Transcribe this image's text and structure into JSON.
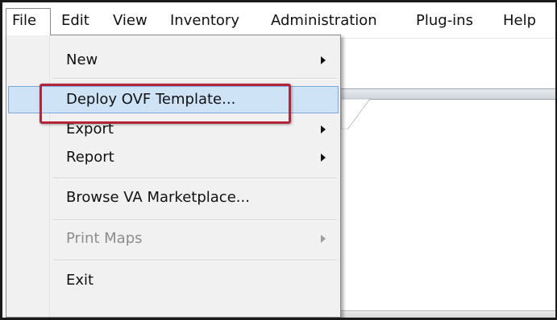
{
  "menubar": {
    "items": [
      {
        "label": "File"
      },
      {
        "label": "Edit"
      },
      {
        "label": "View"
      },
      {
        "label": "Inventory"
      },
      {
        "label": "Administration"
      },
      {
        "label": "Plug-ins"
      },
      {
        "label": "Help"
      }
    ],
    "active_menu": "File"
  },
  "file_menu": {
    "items": [
      {
        "label": "New",
        "has_submenu": true,
        "enabled": true
      },
      {
        "label": "Deploy OVF Template...",
        "has_submenu": false,
        "enabled": true,
        "highlighted": true
      },
      {
        "label": "Export",
        "has_submenu": true,
        "enabled": true
      },
      {
        "label": "Report",
        "has_submenu": true,
        "enabled": true
      },
      {
        "label": "Browse VA Marketplace...",
        "has_submenu": false,
        "enabled": true
      },
      {
        "label": "Print Maps",
        "has_submenu": true,
        "enabled": false
      },
      {
        "label": "Exit",
        "has_submenu": false,
        "enabled": true
      }
    ]
  },
  "colors": {
    "highlight_fill": "#cfe3f7",
    "highlight_border": "#7aa7d8",
    "callout_border": "#b3263a",
    "menu_background": "#f1f1f1",
    "disabled_text": "#8d8d8d"
  }
}
